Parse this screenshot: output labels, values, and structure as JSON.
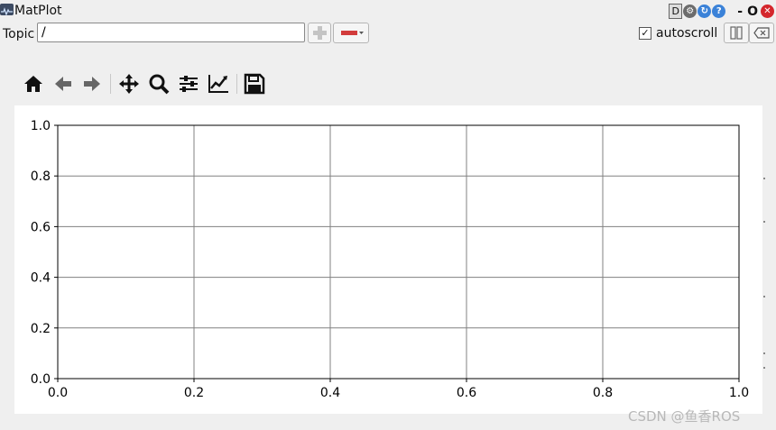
{
  "window": {
    "title": "MatPlot",
    "debug_label": "D",
    "help_label": "?",
    "minimize_label": "-",
    "maximize_label": "O"
  },
  "topic_bar": {
    "label": "Topic",
    "topic_value": "/",
    "autoscroll_label": "autoscroll",
    "autoscroll_checked": true
  },
  "toolbar": {
    "tools": [
      "home-icon",
      "back-arrow-icon",
      "forward-arrow-icon",
      "pan-icon",
      "zoom-icon",
      "subplots-config-icon",
      "edit-curves-icon",
      "save-icon"
    ]
  },
  "chart_data": {
    "type": "line",
    "series": [],
    "x": [],
    "xlim": [
      0.0,
      1.0
    ],
    "ylim": [
      0.0,
      1.0
    ],
    "xticks": [
      "0.0",
      "0.2",
      "0.4",
      "0.6",
      "0.8",
      "1.0"
    ],
    "yticks": [
      "0.0",
      "0.2",
      "0.4",
      "0.6",
      "0.8",
      "1.0"
    ],
    "grid": true,
    "title": "",
    "xlabel": "",
    "ylabel": ""
  },
  "watermark": "CSDN @鱼香ROS",
  "colors": {
    "remove_button": "#d23c3c",
    "close_button": "#d4262c",
    "help_button": "#3b82d8",
    "refresh_button": "#3b82d8",
    "settings_button": "#6c6c6c"
  }
}
